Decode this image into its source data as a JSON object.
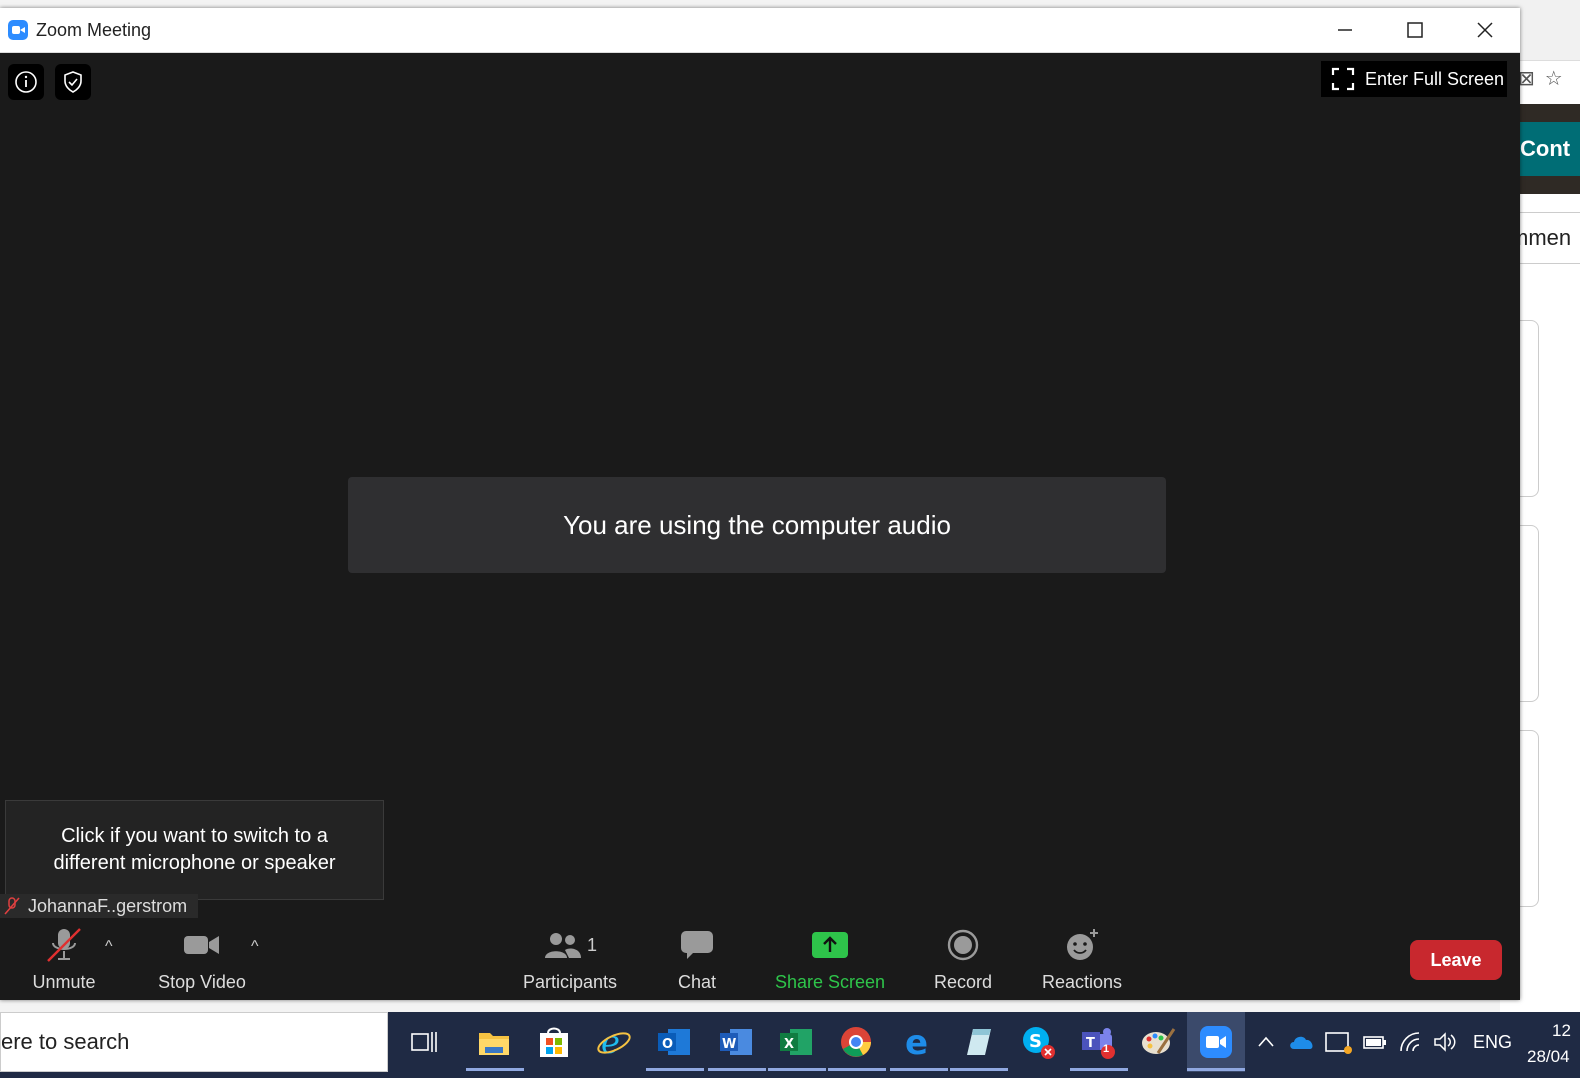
{
  "window": {
    "title": "Zoom Meeting",
    "fullscreen_label": "Enter Full Screen"
  },
  "toast": {
    "message": "You are using the computer audio"
  },
  "tooltip": {
    "line1": "Click if you want to switch to a",
    "line2": "different microphone or speaker"
  },
  "participant": {
    "name": "JohannaF..gerstrom"
  },
  "toolbar": {
    "unmute": "Unmute",
    "stop_video": "Stop Video",
    "participants": "Participants",
    "participants_count": "1",
    "chat": "Chat",
    "share_screen": "Share Screen",
    "record": "Record",
    "reactions": "Reactions",
    "leave": "Leave"
  },
  "background": {
    "cont_button": "Cont",
    "mmen_text": "mmen"
  },
  "taskbar": {
    "search_placeholder": "ere to search",
    "language": "ENG",
    "time": "12",
    "date": "28/04",
    "teams_badge": "1"
  },
  "colors": {
    "zoom_blue": "#2d8cff",
    "share_green": "#2ec44a",
    "leave_red": "#c8282e",
    "meeting_bg": "#1a1a1a"
  }
}
